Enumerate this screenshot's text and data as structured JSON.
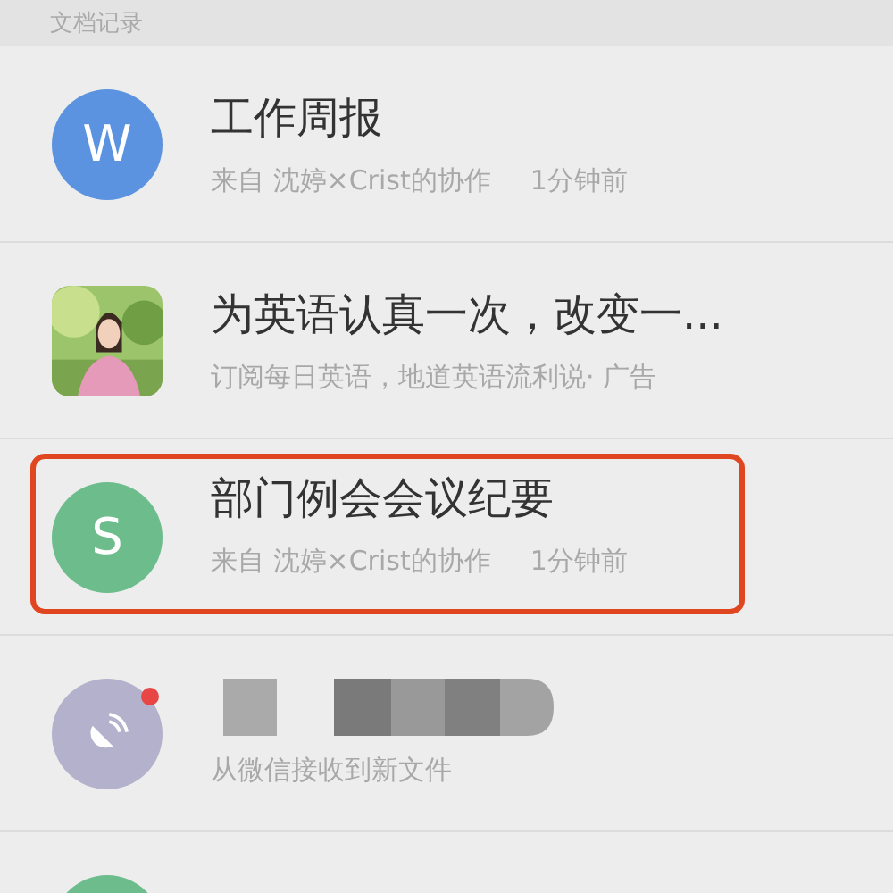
{
  "section_header": {
    "title": "文档记录"
  },
  "records": [
    {
      "avatar": {
        "kind": "letter",
        "letter": "W",
        "color": "#5b93e0"
      },
      "title": "工作周报",
      "subtitle": "来自 沈婷×Crist的协作",
      "time": "1分钟前"
    },
    {
      "title": "为英语认真一次，改变一...",
      "subtitle": "订阅每日英语，地道英语流利说· 广告"
    },
    {
      "avatar": {
        "kind": "letter",
        "letter": "S",
        "color": "#6cbc8c"
      },
      "title": "部门例会会议纪要",
      "subtitle": "来自 沈婷×Crist的协作",
      "time": "1分钟前",
      "highlighted": true
    },
    {
      "avatar": {
        "kind": "icon",
        "color": "#b3b1cb"
      },
      "subtitle": "从微信接收到新文件",
      "unread": true,
      "redacted": true
    },
    {
      "avatar": {
        "kind": "blank",
        "color": "#6cbc8c"
      }
    }
  ]
}
